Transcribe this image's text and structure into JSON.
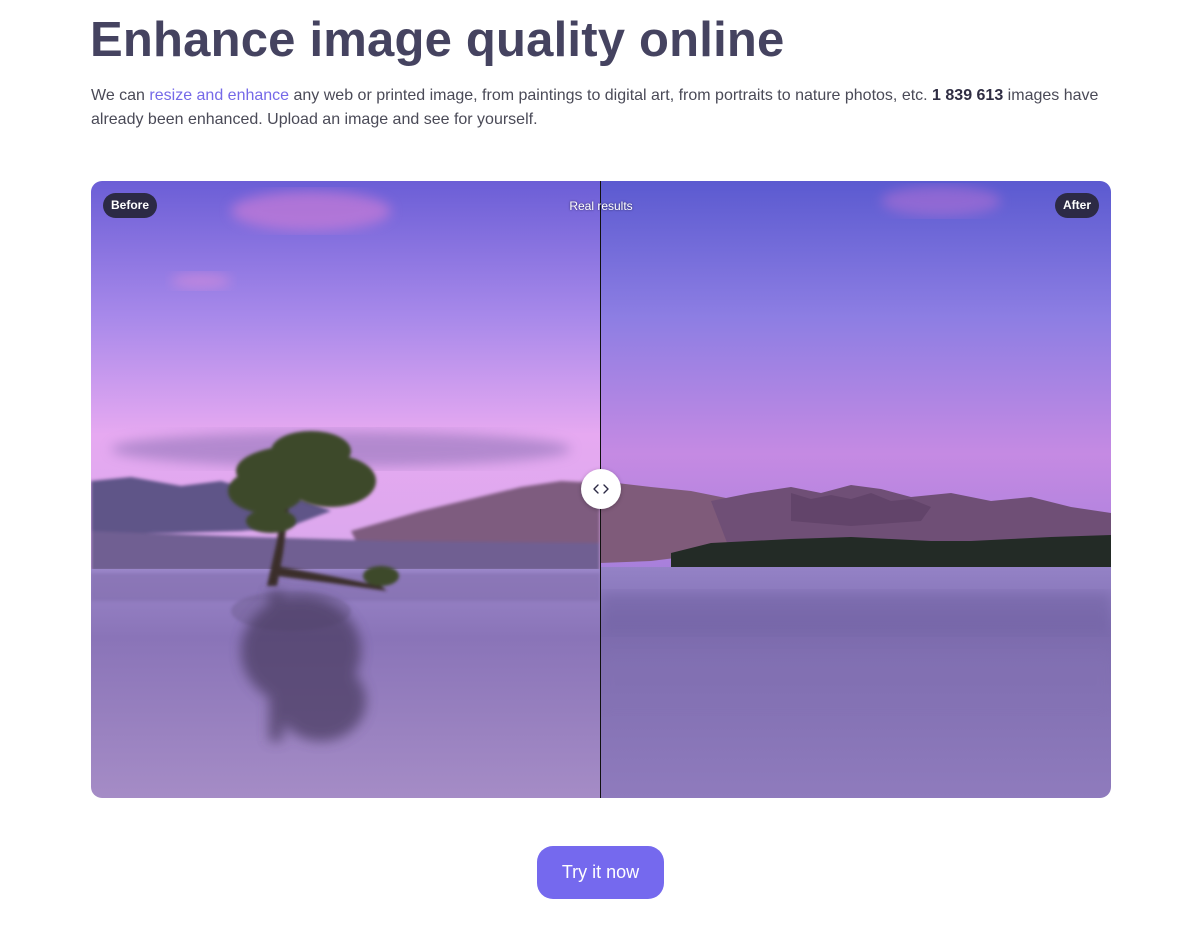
{
  "heading": "Enhance image quality online",
  "intro": {
    "part1": "We can ",
    "link": "resize and enhance",
    "part2": " any web or printed image, from paintings to digital art, from portraits to nature photos, etc. ",
    "count": "1 839 613",
    "part3": " images have already been enhanced. Upload an image and see for yourself."
  },
  "comparison": {
    "before_label": "Before",
    "center_label": "Real results",
    "after_label": "After",
    "handle_icon": "chevrons-left-right-icon"
  },
  "cta": {
    "label": "Try it now"
  },
  "colors": {
    "heading": "#454360",
    "link": "#7569e8",
    "button": "#7569ee",
    "badge": "#2c2a45"
  }
}
